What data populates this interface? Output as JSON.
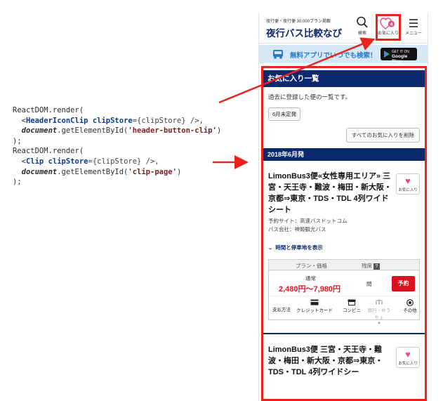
{
  "code": {
    "lines": [
      [
        {
          "t": "ReactDOM.render(",
          "c": "kw"
        }
      ],
      [
        {
          "t": "  <",
          "c": "kw"
        },
        {
          "t": "HeaderIconClip",
          "c": "tag"
        },
        {
          "t": " ",
          "c": "kw"
        },
        {
          "t": "clipStore",
          "c": "attr"
        },
        {
          "t": "={clipStore} />,",
          "c": "var"
        }
      ],
      [
        {
          "t": "  ",
          "c": "kw"
        },
        {
          "t": "document",
          "c": "obj"
        },
        {
          "t": ".getElementById(",
          "c": "fn"
        },
        {
          "t": "'header-button-clip'",
          "c": "str"
        },
        {
          "t": ")",
          "c": "fn"
        }
      ],
      [
        {
          "t": ");",
          "c": "kw"
        }
      ],
      [
        {
          "t": "ReactDOM.render(",
          "c": "kw"
        }
      ],
      [
        {
          "t": "  <",
          "c": "kw"
        },
        {
          "t": "Clip",
          "c": "tag"
        },
        {
          "t": " ",
          "c": "kw"
        },
        {
          "t": "clipStore",
          "c": "attr"
        },
        {
          "t": "={clipStore} />,",
          "c": "var"
        }
      ],
      [
        {
          "t": "  ",
          "c": "kw"
        },
        {
          "t": "document",
          "c": "obj"
        },
        {
          "t": ".getElementById(",
          "c": "fn"
        },
        {
          "t": "'clip-page'",
          "c": "str"
        },
        {
          "t": ")",
          "c": "fn"
        }
      ],
      [
        {
          "t": ");",
          "c": "kw"
        }
      ]
    ]
  },
  "header": {
    "tagline": "夜行便・夜行便 30,000プラン掲載",
    "logo": "夜行バス比較なび",
    "search_label": "検索",
    "fav_label": "お気に入り",
    "fav_count": "4",
    "menu_label": "メニュー"
  },
  "app_banner": {
    "text": "無料アプリでいつでも検索！",
    "store_line1": "GET IT ON",
    "store_line2": "Google Play"
  },
  "clip_page": {
    "title": "お気に入り一覧",
    "intro": "過去に登録した便の一覧です。",
    "month_filter": "6月未定発",
    "delete_all": "すべてのお気に入りを削除",
    "month_header": "2018年6月発",
    "fav_button_label": "お気に入り",
    "cards": [
      {
        "title": "LimonBus3便«女性専用エリア» 三宮・天王寺・難波・梅田・新大阪・京都⇒東京・TDS・TDL 4列ワイドシート",
        "site": "予約サイト：高速バスドットコム",
        "company": "バス会社：神姫観光バス",
        "toggle": "時間と停車地を表示",
        "price_header": "プラン・価格",
        "seat_header": "残席",
        "seat_help": "?",
        "plan": "通常",
        "price": "2,480円〜7,980円",
        "seat": "問",
        "book": "予約",
        "pay_label": "支払方法",
        "pay_methods": [
          {
            "name": "クレジットカード",
            "icon": "credit-card-icon",
            "enabled": true
          },
          {
            "name": "コンビニ",
            "icon": "convenience-store-icon",
            "enabled": true
          },
          {
            "name": "銀行・ゆうちょ",
            "icon": "bank-icon",
            "enabled": false
          },
          {
            "name": "その他",
            "icon": "other-payment-icon",
            "enabled": true
          }
        ]
      },
      {
        "title": "LimonBus3便 三宮・天王寺・難波・梅田・新大阪・京都⇒東京・TDS・TDL 4列ワイドシー"
      }
    ]
  },
  "colors": {
    "highlight_red": "#e8231b",
    "navy": "#0d2a6e",
    "price_red": "#e0161e",
    "heart_pink": "#f04a7a"
  }
}
